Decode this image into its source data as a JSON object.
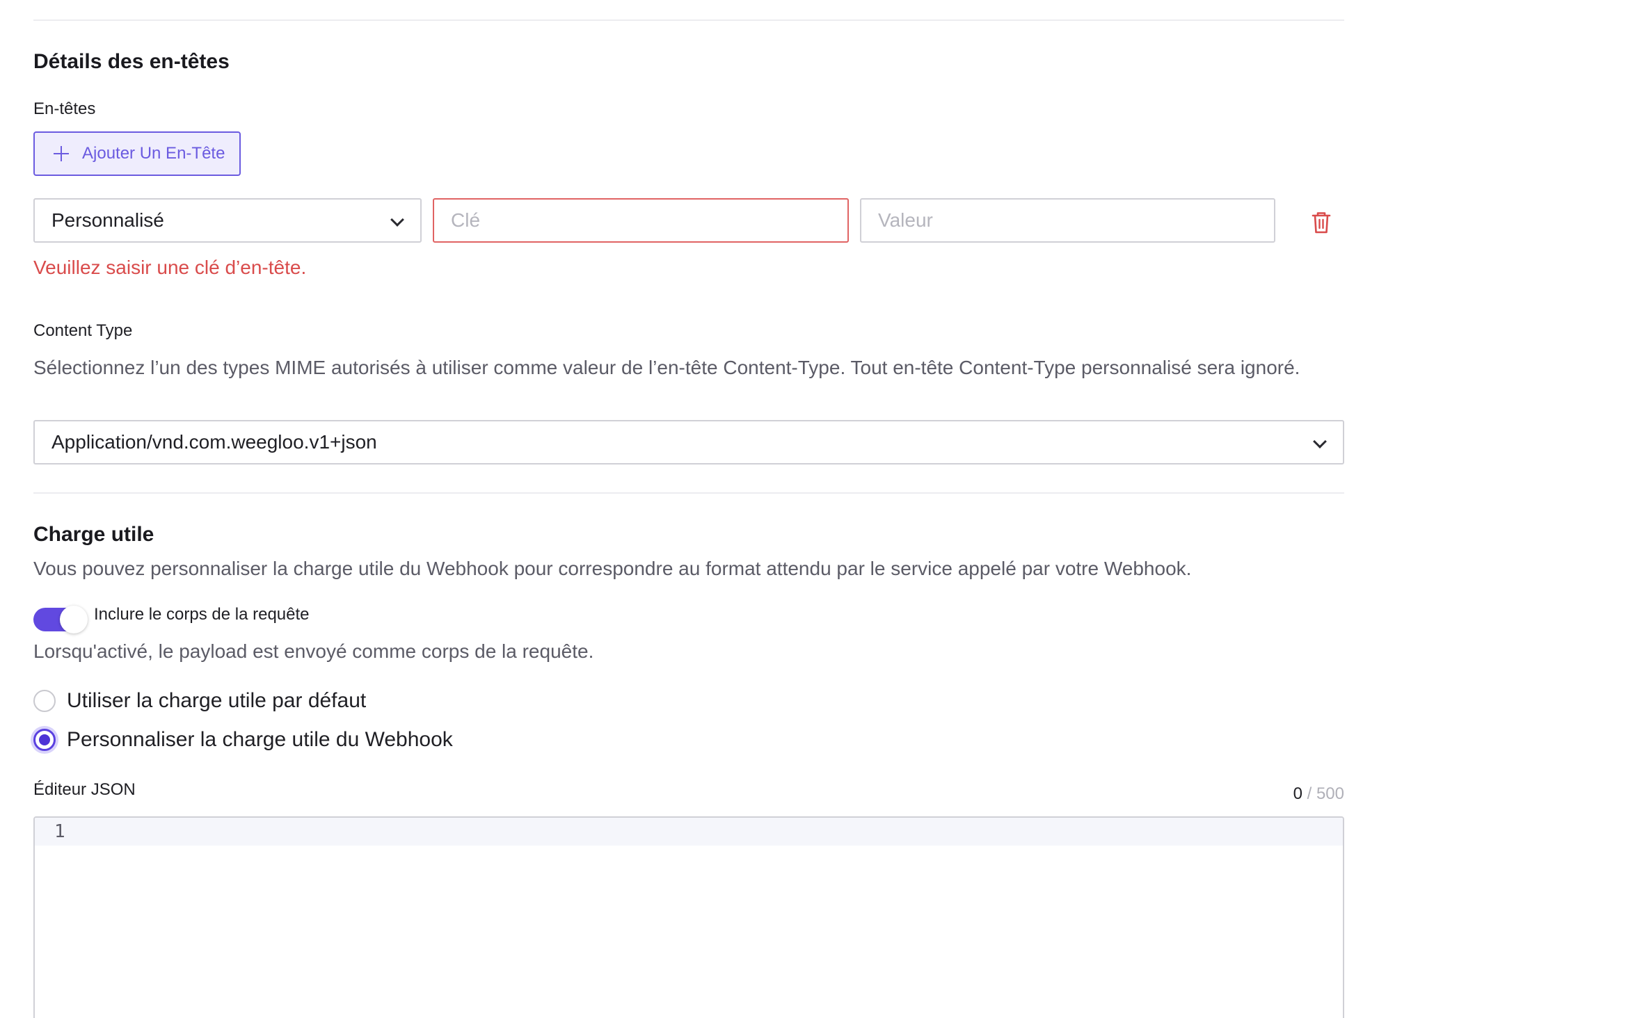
{
  "header_section": {
    "title": "Détails des en-têtes",
    "headers_label": "En-têtes",
    "add_button_label": "Ajouter Un En-Tête",
    "header_row": {
      "type_value": "Personnalisé",
      "key_placeholder": "Clé",
      "value_placeholder": "Valeur"
    },
    "error_message": "Veuillez saisir une clé d’en-tête."
  },
  "content_type": {
    "label": "Content Type",
    "help": "Sélectionnez l’un des types MIME autorisés à utiliser comme valeur de l’en-tête Content-Type. Tout en-tête Content-Type personnalisé sera ignoré.",
    "value": "Application/vnd.com.weegloo.v1+json"
  },
  "payload_section": {
    "title": "Charge utile",
    "description": "Vous pouvez personnaliser la charge utile du Webhook pour correspondre au format attendu par le service appelé par votre Webhook.",
    "toggle_label": "Inclure le corps de la requête",
    "toggle_on": true,
    "toggle_help": "Lorsqu'activé, le payload est envoyé comme corps de la requête.",
    "radio_default": "Utiliser la charge utile par défaut",
    "radio_custom": "Personnaliser la charge utile du Webhook",
    "selected_option": "custom",
    "editor_label": "Éditeur JSON",
    "count_current": "0",
    "count_max": " / 500",
    "line_number": "1"
  },
  "colors": {
    "accent": "#6149e0",
    "error": "#d94b4b",
    "border": "#d0d0d6"
  },
  "icons": {
    "add": "plus-icon",
    "select": "chevron-down-icon",
    "delete": "trash-icon"
  }
}
